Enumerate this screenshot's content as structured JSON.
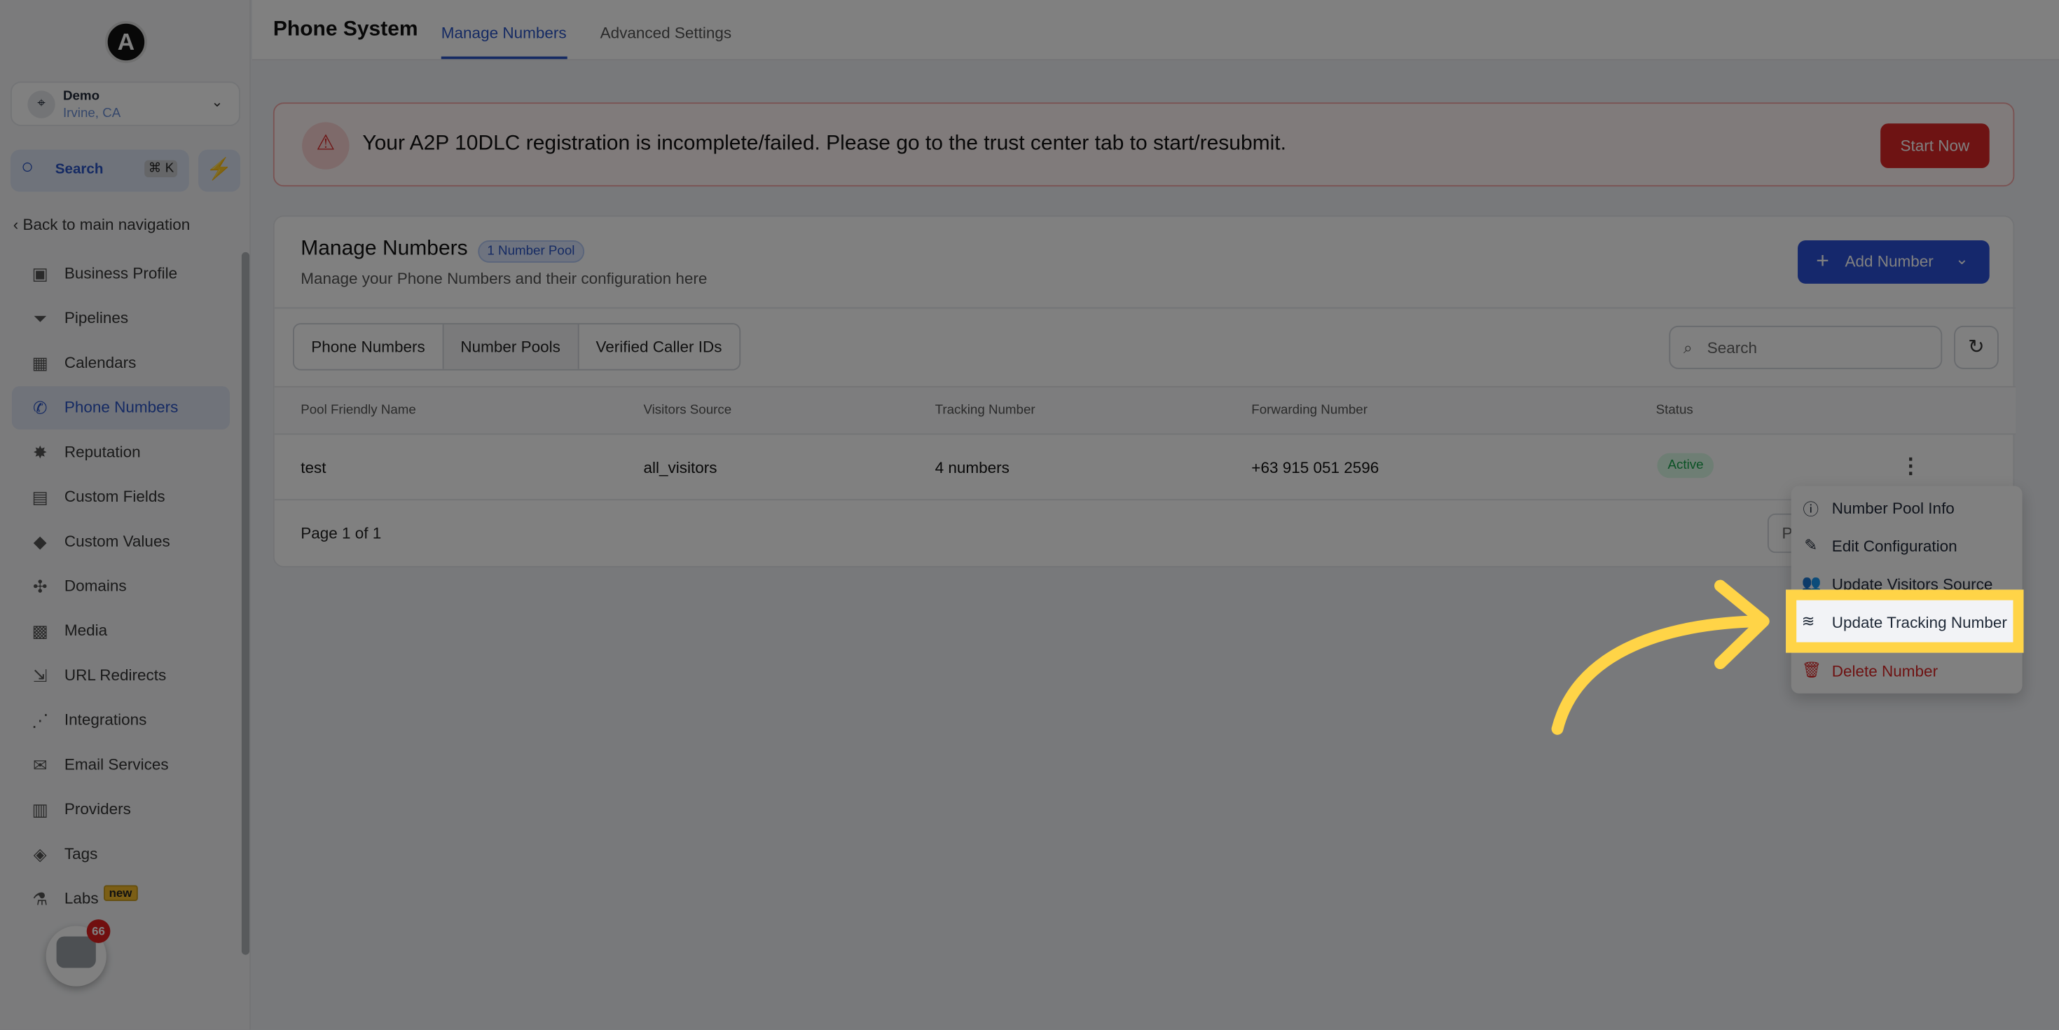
{
  "sidebar": {
    "logo_letter": "A",
    "location": {
      "name": "Demo",
      "city": "Irvine, CA"
    },
    "search_label": "Search",
    "search_shortcut": "⌘ K",
    "back_label": "Back to main navigation",
    "items": [
      {
        "label": "Business Profile",
        "icon": "briefcase-icon"
      },
      {
        "label": "Pipelines",
        "icon": "funnel-icon"
      },
      {
        "label": "Calendars",
        "icon": "calendar-icon"
      },
      {
        "label": "Phone Numbers",
        "icon": "phone-icon",
        "active": true
      },
      {
        "label": "Reputation",
        "icon": "star-icon"
      },
      {
        "label": "Custom Fields",
        "icon": "fields-icon"
      },
      {
        "label": "Custom Values",
        "icon": "diamond-icon"
      },
      {
        "label": "Domains",
        "icon": "globe-icon"
      },
      {
        "label": "Media",
        "icon": "media-icon"
      },
      {
        "label": "URL Redirects",
        "icon": "redirect-icon"
      },
      {
        "label": "Integrations",
        "icon": "integrations-icon"
      },
      {
        "label": "Email Services",
        "icon": "mail-icon"
      },
      {
        "label": "Providers",
        "icon": "clipboard-icon"
      },
      {
        "label": "Tags",
        "icon": "tag-icon"
      },
      {
        "label": "Labs",
        "icon": "flask-icon"
      }
    ],
    "labs_badge": "new",
    "chat_count": "66"
  },
  "header": {
    "title": "Phone System",
    "tabs": [
      {
        "label": "Manage Numbers",
        "active": true
      },
      {
        "label": "Advanced Settings"
      }
    ]
  },
  "alert": {
    "message": "Your A2P 10DLC registration is incomplete/failed. Please go to the trust center tab to start/resubmit.",
    "button": "Start Now"
  },
  "card": {
    "title": "Manage Numbers",
    "badge": "1 Number Pool",
    "subtitle": "Manage your Phone Numbers and their configuration here",
    "add_button": "Add Number",
    "segments": [
      "Phone Numbers",
      "Number Pools",
      "Verified Caller IDs"
    ],
    "active_segment": "Number Pools",
    "search_placeholder": "Search",
    "columns": [
      "Pool Friendly Name",
      "Visitors Source",
      "Tracking Number",
      "Forwarding Number",
      "Status"
    ],
    "rows": [
      {
        "name": "test",
        "source": "all_visitors",
        "tracking": "4 numbers",
        "forwarding": "+63 915 051 2596",
        "status": "Active"
      }
    ],
    "page_info": "Page 1 of 1",
    "pagination_partial": "P"
  },
  "menu": {
    "items": [
      {
        "label": "Number Pool Info",
        "icon": "info-icon"
      },
      {
        "label": "Edit Configuration",
        "icon": "pencil-icon"
      },
      {
        "label": "Update Visitors Source",
        "icon": "users-icon"
      },
      {
        "label": "Update Tracking Number",
        "icon": "tracking-icon",
        "highlighted": true
      },
      {
        "label": "Delete Number",
        "icon": "trash-icon",
        "danger": true
      }
    ]
  },
  "colors": {
    "accent": "#2a4fd8",
    "danger": "#dc2626",
    "highlight": "#ffd447",
    "success": "#16a34a"
  }
}
